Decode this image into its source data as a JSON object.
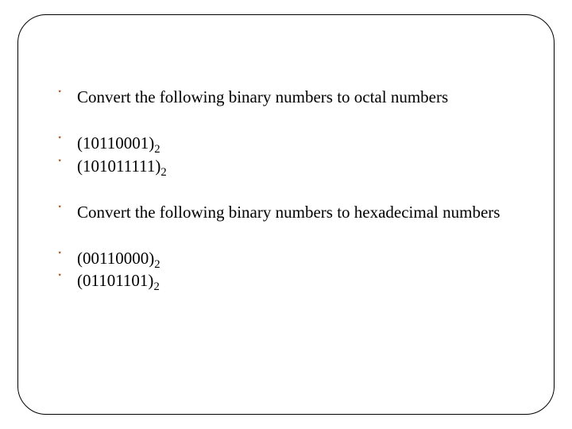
{
  "bulletGlyph": "་",
  "items": [
    {
      "text": "Convert the following binary numbers to octal numbers",
      "sub": ""
    },
    {
      "text": "(10110001)",
      "sub": "2"
    },
    {
      "text": "(101011111)",
      "sub": "2"
    },
    {
      "text": "Convert the following binary numbers to hexadecimal numbers",
      "sub": ""
    },
    {
      "text": "(00110000)",
      "sub": "2"
    },
    {
      "text": "(01101101)",
      "sub": "2"
    }
  ]
}
